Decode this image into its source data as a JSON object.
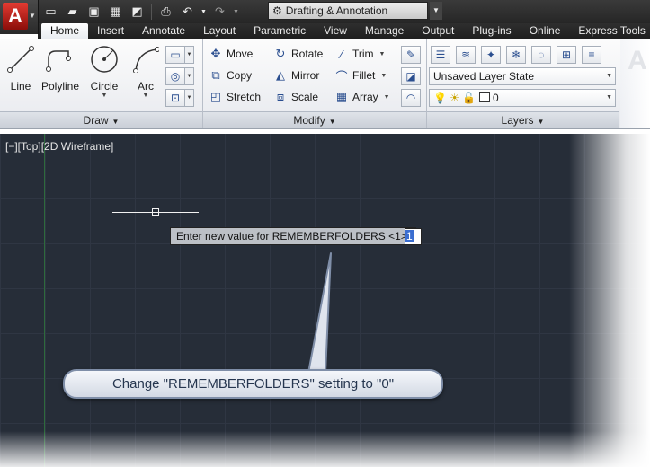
{
  "quick_access": {
    "icons": [
      "new-icon",
      "open-icon",
      "save-icon",
      "save-as-icon",
      "publish-icon",
      "print-icon",
      "undo-icon",
      "redo-icon"
    ],
    "app_letter": "A",
    "workspace": "Drafting & Annotation"
  },
  "tabs": [
    {
      "label": "Home",
      "active": true
    },
    {
      "label": "Insert"
    },
    {
      "label": "Annotate"
    },
    {
      "label": "Layout"
    },
    {
      "label": "Parametric"
    },
    {
      "label": "View"
    },
    {
      "label": "Manage"
    },
    {
      "label": "Output"
    },
    {
      "label": "Plug-ins"
    },
    {
      "label": "Online"
    },
    {
      "label": "Express Tools"
    }
  ],
  "ribbon": {
    "draw": {
      "title": "Draw",
      "line": "Line",
      "polyline": "Polyline",
      "circle": "Circle",
      "arc": "Arc"
    },
    "modify": {
      "title": "Modify",
      "move": "Move",
      "rotate": "Rotate",
      "trim": "Trim",
      "copy": "Copy",
      "mirror": "Mirror",
      "fillet": "Fillet",
      "stretch": "Stretch",
      "scale": "Scale",
      "array": "Array"
    },
    "layers": {
      "title": "Layers",
      "layer_state": "Unsaved Layer State",
      "current_layer": "0"
    }
  },
  "viewport": {
    "label": "[−][Top][2D Wireframe]",
    "prompt": "Enter new value for REMEMBERFOLDERS <1>:",
    "input_value": "1"
  },
  "callout": {
    "text": "Change \"REMEMBERFOLDERS\" setting to \"0\""
  },
  "colors": {
    "canvas": "#262d38",
    "callout_border": "#7f8ea8",
    "app_red": "#c8221c"
  }
}
